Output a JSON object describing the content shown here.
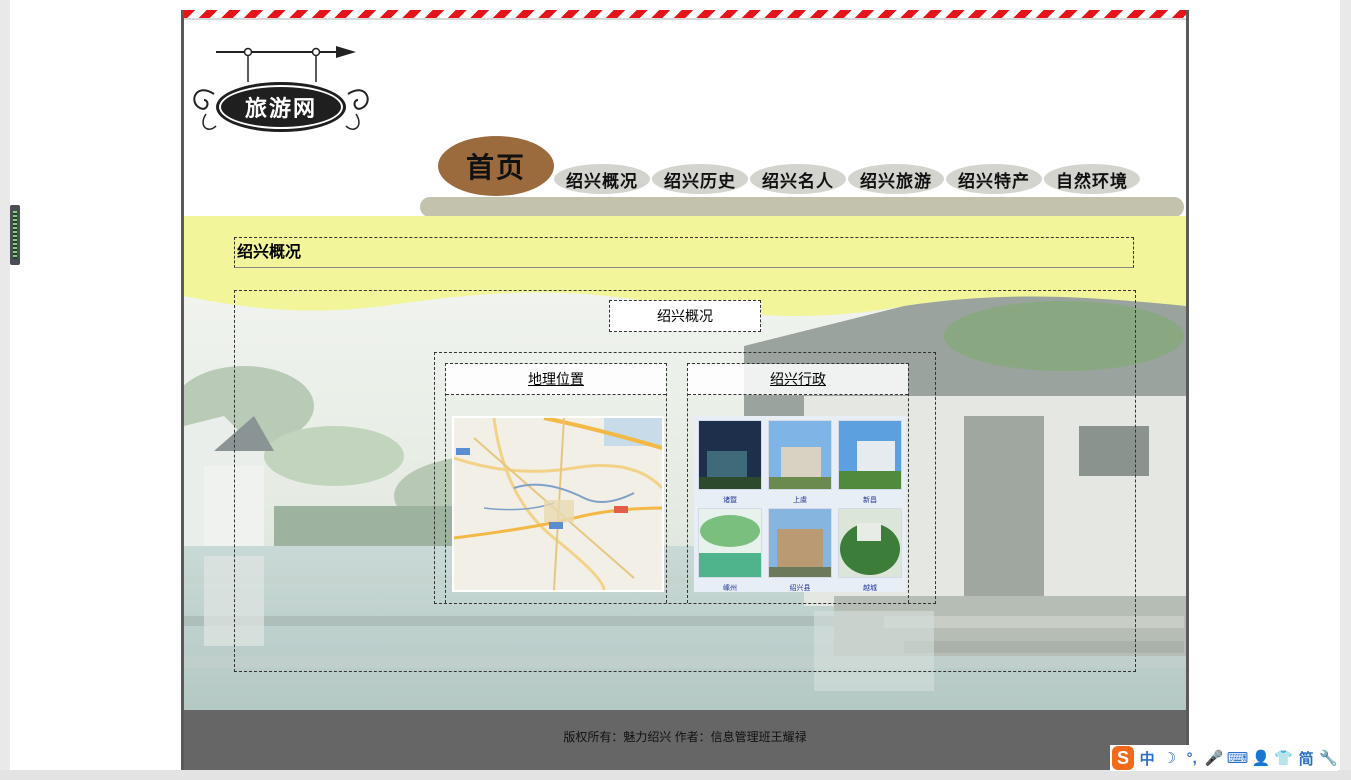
{
  "logo": {
    "text": "旅游网"
  },
  "nav": {
    "home": "首页",
    "items": [
      "绍兴概况",
      "绍兴历史",
      "绍兴名人",
      "绍兴旅游",
      "绍兴特产",
      "自然环境"
    ]
  },
  "section": {
    "title": "绍兴概况"
  },
  "main": {
    "subtitle": "绍兴概况",
    "columns": [
      {
        "title": "地理位置"
      },
      {
        "title": "绍兴行政"
      }
    ],
    "thumbs": [
      "诸暨",
      "上虞",
      "新昌",
      "嵊州",
      "绍兴县",
      "越城"
    ]
  },
  "footer": {
    "text": "版权所有：魅力绍兴 作者：信息管理班王耀禄"
  },
  "ime": {
    "logo": "S",
    "buttons": [
      "中",
      "☽",
      "°,",
      "🎤",
      "⌨",
      "👤",
      "👕",
      "简",
      "🔧"
    ]
  },
  "colors": {
    "stripe": "#e4141a",
    "home_bg": "#9b6b3e",
    "nav_bg": "#d4d4cf",
    "band": "#f2f59a",
    "footer_bg": "#666666"
  }
}
